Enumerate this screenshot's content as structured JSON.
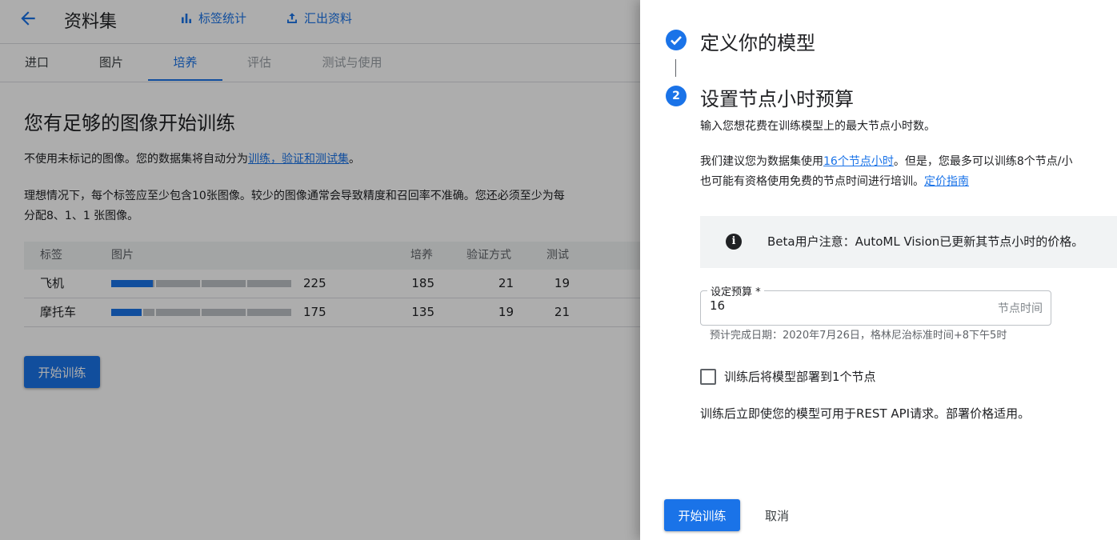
{
  "header": {
    "title": "资料集",
    "actions": [
      {
        "label": "标签统计",
        "icon": "bar-chart-icon"
      },
      {
        "label": "汇出资料",
        "icon": "export-icon"
      }
    ]
  },
  "tabs": [
    {
      "label": "进口",
      "state": "normal"
    },
    {
      "label": "图片",
      "state": "normal"
    },
    {
      "label": "培养",
      "state": "active"
    },
    {
      "label": "评估",
      "state": "disabled"
    },
    {
      "label": "测试与使用",
      "state": "disabled"
    }
  ],
  "main": {
    "heading": "您有足够的图像开始训练",
    "para1_before": "不使用未标记的图像。您的数据集将自动分为",
    "para1_link": "训练，验证和测试集",
    "para1_after": "。",
    "para2_line1": "理想情况下，每个标签应至少包含10张图像。较少的图像通常会导致精度和召回率不准确。您还必须至少为每",
    "para2_line2": "分配8、1、1 张图像。",
    "table": {
      "headers": [
        "标签",
        "图片",
        "培养",
        "验证方式",
        "测试"
      ],
      "rows": [
        {
          "label": "飞机",
          "images": "225",
          "train": "185",
          "validation": "21",
          "test": "19",
          "bar_fraction": 0.23
        },
        {
          "label": "摩托车",
          "images": "175",
          "train": "135",
          "validation": "19",
          "test": "21",
          "bar_fraction": 0.17
        }
      ]
    },
    "start_button": "开始训练"
  },
  "panel": {
    "step1": {
      "number": "✓",
      "title": "定义你的模型"
    },
    "step2": {
      "number": "2",
      "title": "设置节点小时预算"
    },
    "subtitle": "输入您想花费在训练模型上的最大节点小时数。",
    "recommend_before": "我们建议您为数据集使用",
    "recommend_link": "16个节点小时",
    "recommend_after": "。但是，您最多可以训练8个节点/小",
    "free_line": "也可能有资格使用免费的节点时间进行培训。",
    "pricing_link": "定价指南",
    "notice": "Beta用户注意：AutoML Vision已更新其节点小时的价格。",
    "budget_label": "设定预算 *",
    "budget_value": "16",
    "budget_suffix": "节点时间",
    "hint": "预计完成日期：2020年7月26日，格林尼治标准时间+8下午5时",
    "deploy_checkbox_label": "训练后将模型部署到1个节点",
    "deploy_checked": false,
    "deploy_note": "训练后立即使您的模型可用于REST API请求。部署价格适用。",
    "primary_button": "开始训练",
    "cancel_button": "取消"
  },
  "colors": {
    "accent": "#1a73e8",
    "scrim": "rgba(0,0,0,0.32)"
  }
}
